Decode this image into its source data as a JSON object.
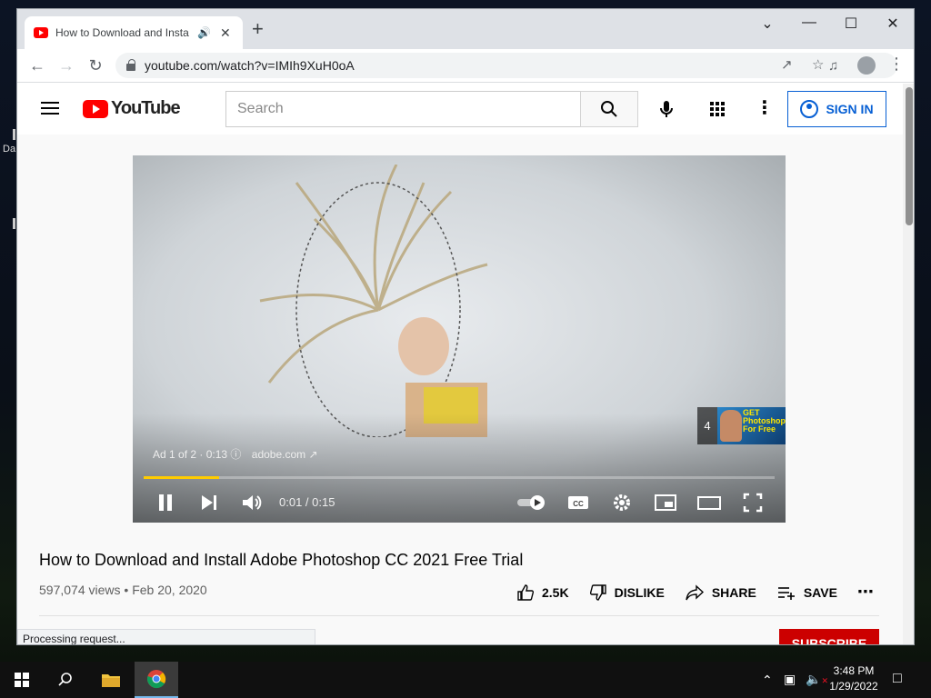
{
  "browser": {
    "tab_title": "How to Download and Insta",
    "url": "youtube.com/watch?v=IMIh9XuH0oA",
    "status_text": "Processing request..."
  },
  "youtube": {
    "logo_text": "YouTube",
    "search_placeholder": "Search",
    "sign_in_label": "SIGN IN"
  },
  "player": {
    "ad_label": "Ad 1 of 2 · 0:13",
    "ad_domain": "adobe.com",
    "ad_next_number": "4",
    "ad_thumb_text": "GET Photoshop For Free",
    "time": "0:01 / 0:15",
    "progress_fraction": 0.12
  },
  "video": {
    "title": "How to Download and Install Adobe Photoshop CC 2021 Free Trial",
    "views": "597,074 views",
    "date": "Feb 20, 2020",
    "like_count": "2.5K",
    "dislike_label": "DISLIKE",
    "share_label": "SHARE",
    "save_label": "SAVE",
    "subscribe_label": "SUBSCRIBE"
  },
  "taskbar": {
    "time": "3:48 PM",
    "date": "1/29/2022"
  },
  "colors": {
    "youtube_red": "#ff0000",
    "link_blue": "#065fd4",
    "ad_progress": "#ffcc00"
  }
}
